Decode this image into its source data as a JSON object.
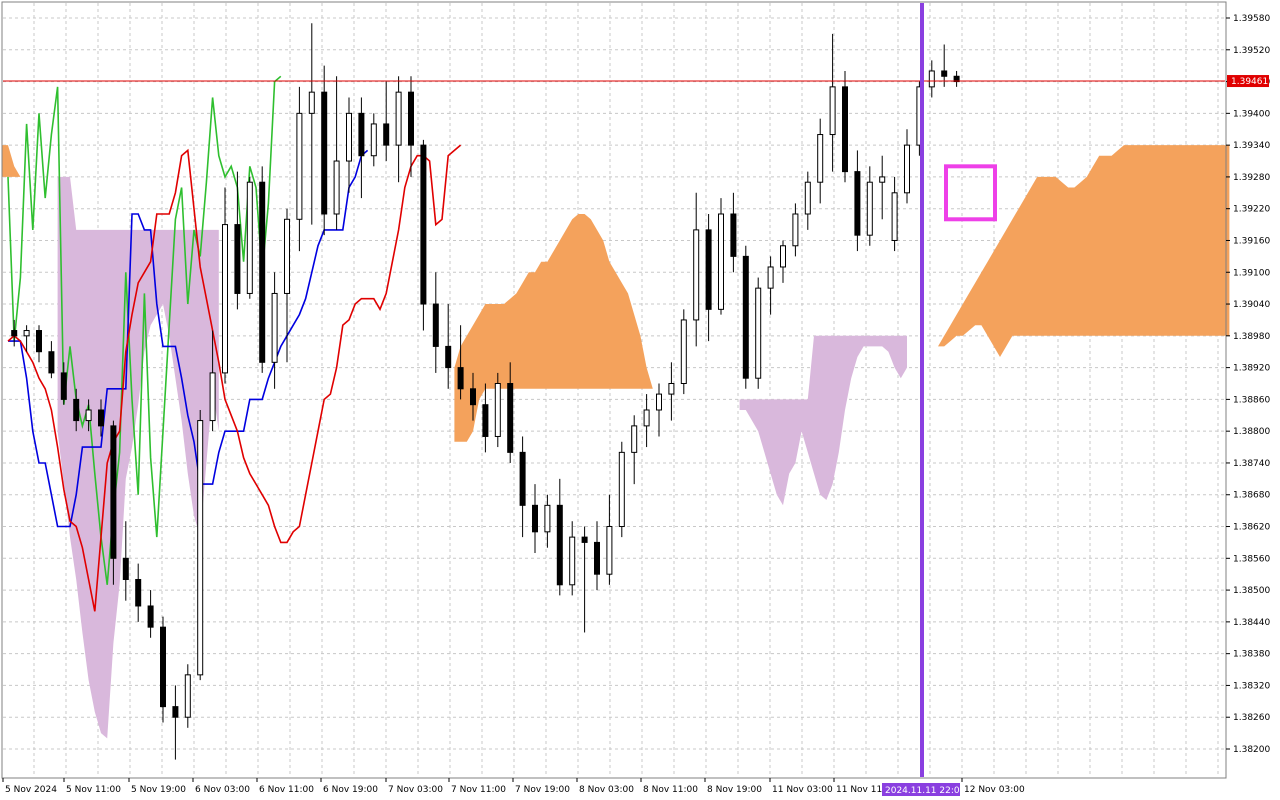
{
  "chart_data": {
    "type": "candlestick",
    "instrument_price_axis": {
      "ylim": [
        1.3817,
        1.3961
      ],
      "ticks": [
        "1.39580",
        "1.39520",
        "1.39460",
        "1.39400",
        "1.39340",
        "1.39280",
        "1.39220",
        "1.39160",
        "1.39100",
        "1.39040",
        "1.38980",
        "1.38920",
        "1.38860",
        "1.38800",
        "1.38740",
        "1.38680",
        "1.38620",
        "1.38560",
        "1.38500",
        "1.38440",
        "1.38380",
        "1.38320",
        "1.38260",
        "1.38200"
      ]
    },
    "time_axis": {
      "ticks": [
        "5 Nov 2024",
        "5 Nov 11:00",
        "5 Nov 19:00",
        "6 Nov 03:00",
        "6 Nov 11:00",
        "6 Nov 19:00",
        "7 Nov 03:00",
        "7 Nov 11:00",
        "7 Nov 19:00",
        "8 Nov 03:00",
        "8 Nov 11:00",
        "8 Nov 19:00",
        "11 Nov 03:00",
        "11 Nov 11:00",
        "12 Nov 03:00"
      ]
    },
    "current_price": {
      "label": "1.39461",
      "value": 1.39461,
      "color": "#e00000"
    },
    "vertical_marker": {
      "label": "2024.11.11 22:00",
      "color": "#8a3fe0"
    },
    "highlight_box": {
      "color": "#ee40e8",
      "price_range": [
        1.392,
        1.393
      ]
    },
    "colors": {
      "grid": "#c8c8c8",
      "tenkan": "#e00000",
      "kijun": "#0000e0",
      "chikou": "#2fbf2f",
      "kumo_bull": "#f4a25c",
      "kumo_bear": "#d9b8dc",
      "candle_bull": "#ffffff",
      "candle_bear": "#000000"
    },
    "tenkan": [
      1.3897,
      1.3898,
      1.3897,
      1.3895,
      1.3893,
      1.389,
      1.3888,
      1.3884,
      1.3877,
      1.3869,
      1.3863,
      1.3862,
      1.3858,
      1.3852,
      1.3846,
      1.386,
      1.3874,
      1.3878,
      1.388,
      1.3895,
      1.3902,
      1.3908,
      1.391,
      1.3912,
      1.3921,
      1.3921,
      1.3921,
      1.3925,
      1.3932,
      1.3933,
      1.3922,
      1.3911,
      1.3905,
      1.3899,
      1.3893,
      1.3886,
      1.3883,
      1.388,
      1.3875,
      1.3872,
      1.387,
      1.3868,
      1.3866,
      1.3862,
      1.3859,
      1.3859,
      1.3861,
      1.3862,
      1.3868,
      1.3874,
      1.388,
      1.3886,
      1.3887,
      1.3892,
      1.39,
      1.3901,
      1.3904,
      1.3905,
      1.3905,
      1.3905,
      1.3903,
      1.3906,
      1.3912,
      1.3918,
      1.3926,
      1.393,
      1.3932,
      1.3932,
      1.3931,
      1.3919,
      1.392,
      1.3932,
      1.3933,
      1.3934
    ],
    "kijun": [
      1.3897,
      1.3897,
      1.3897,
      1.389,
      1.388,
      1.3874,
      1.3874,
      1.3868,
      1.3862,
      1.3862,
      1.3862,
      1.3868,
      1.3877,
      1.3877,
      1.3877,
      1.3877,
      1.3888,
      1.3888,
      1.3888,
      1.3888,
      1.3921,
      1.3921,
      1.3918,
      1.3918,
      1.3904,
      1.3896,
      1.3896,
      1.3896,
      1.389,
      1.3883,
      1.3878,
      1.387,
      1.387,
      1.387,
      1.3876,
      1.388,
      1.388,
      1.388,
      1.388,
      1.3886,
      1.3886,
      1.3886,
      1.389,
      1.3893,
      1.3896,
      1.3898,
      1.39,
      1.3902,
      1.3905,
      1.391,
      1.3915,
      1.3918,
      1.3918,
      1.3918,
      1.3918,
      1.3926,
      1.3928,
      1.3932,
      1.3933
    ],
    "chikou": [
      1.3928,
      1.3897,
      1.3909,
      1.3938,
      1.3918,
      1.394,
      1.3924,
      1.3936,
      1.3945,
      1.3885,
      1.3896,
      1.3886,
      1.3881,
      1.3885,
      1.3872,
      1.386,
      1.3851,
      1.3865,
      1.3876,
      1.391,
      1.3886,
      1.3868,
      1.3906,
      1.3875,
      1.386,
      1.388,
      1.39,
      1.392,
      1.3926,
      1.3904,
      1.3918,
      1.3913,
      1.3927,
      1.3943,
      1.3932,
      1.3928,
      1.393,
      1.3926,
      1.3912,
      1.393,
      1.3926,
      1.391,
      1.3923,
      1.3946,
      1.3947
    ],
    "candles": [
      {
        "o": 1.3899,
        "h": 1.3901,
        "l": 1.3896,
        "c": 1.3898
      },
      {
        "o": 1.3898,
        "h": 1.39,
        "l": 1.3895,
        "c": 1.3899
      },
      {
        "o": 1.3899,
        "h": 1.39,
        "l": 1.3893,
        "c": 1.3895
      },
      {
        "o": 1.3895,
        "h": 1.3897,
        "l": 1.389,
        "c": 1.3891
      },
      {
        "o": 1.3891,
        "h": 1.3893,
        "l": 1.3885,
        "c": 1.3886
      },
      {
        "o": 1.3886,
        "h": 1.3888,
        "l": 1.388,
        "c": 1.3882
      },
      {
        "o": 1.3882,
        "h": 1.3886,
        "l": 1.388,
        "c": 1.3884
      },
      {
        "o": 1.3884,
        "h": 1.3886,
        "l": 1.3879,
        "c": 1.3881
      },
      {
        "o": 1.3881,
        "h": 1.3882,
        "l": 1.3851,
        "c": 1.3856
      },
      {
        "o": 1.3856,
        "h": 1.3863,
        "l": 1.3848,
        "c": 1.3852
      },
      {
        "o": 1.3852,
        "h": 1.3855,
        "l": 1.3844,
        "c": 1.3847
      },
      {
        "o": 1.3847,
        "h": 1.385,
        "l": 1.3841,
        "c": 1.3843
      },
      {
        "o": 1.3843,
        "h": 1.3845,
        "l": 1.3825,
        "c": 1.3828
      },
      {
        "o": 1.3828,
        "h": 1.3832,
        "l": 1.3818,
        "c": 1.3826
      },
      {
        "o": 1.3826,
        "h": 1.3836,
        "l": 1.3824,
        "c": 1.3834
      },
      {
        "o": 1.3834,
        "h": 1.3884,
        "l": 1.3833,
        "c": 1.3882
      },
      {
        "o": 1.3882,
        "h": 1.3899,
        "l": 1.388,
        "c": 1.3891
      },
      {
        "o": 1.3891,
        "h": 1.3926,
        "l": 1.3889,
        "c": 1.3919
      },
      {
        "o": 1.3919,
        "h": 1.3929,
        "l": 1.3903,
        "c": 1.3906
      },
      {
        "o": 1.3906,
        "h": 1.3928,
        "l": 1.3905,
        "c": 1.3927
      },
      {
        "o": 1.3927,
        "h": 1.393,
        "l": 1.3891,
        "c": 1.3893
      },
      {
        "o": 1.3893,
        "h": 1.391,
        "l": 1.3888,
        "c": 1.3906
      },
      {
        "o": 1.3906,
        "h": 1.3922,
        "l": 1.3893,
        "c": 1.392
      },
      {
        "o": 1.392,
        "h": 1.3945,
        "l": 1.3914,
        "c": 1.394
      },
      {
        "o": 1.394,
        "h": 1.3957,
        "l": 1.3919,
        "c": 1.3944
      },
      {
        "o": 1.3944,
        "h": 1.3949,
        "l": 1.3917,
        "c": 1.3921
      },
      {
        "o": 1.3921,
        "h": 1.3947,
        "l": 1.3918,
        "c": 1.3931
      },
      {
        "o": 1.3931,
        "h": 1.3943,
        "l": 1.3925,
        "c": 1.394
      },
      {
        "o": 1.394,
        "h": 1.3943,
        "l": 1.3924,
        "c": 1.3932
      },
      {
        "o": 1.3932,
        "h": 1.394,
        "l": 1.393,
        "c": 1.3938
      },
      {
        "o": 1.3938,
        "h": 1.3946,
        "l": 1.3931,
        "c": 1.3934
      },
      {
        "o": 1.3934,
        "h": 1.3947,
        "l": 1.3927,
        "c": 1.3944
      },
      {
        "o": 1.3944,
        "h": 1.3947,
        "l": 1.3928,
        "c": 1.3934
      },
      {
        "o": 1.3934,
        "h": 1.3935,
        "l": 1.3899,
        "c": 1.3904
      },
      {
        "o": 1.3904,
        "h": 1.391,
        "l": 1.3891,
        "c": 1.3896
      },
      {
        "o": 1.3896,
        "h": 1.3904,
        "l": 1.3888,
        "c": 1.3892
      },
      {
        "o": 1.3892,
        "h": 1.39,
        "l": 1.3886,
        "c": 1.3888
      },
      {
        "o": 1.3888,
        "h": 1.3891,
        "l": 1.3882,
        "c": 1.3885
      },
      {
        "o": 1.3885,
        "h": 1.3889,
        "l": 1.3876,
        "c": 1.3879
      },
      {
        "o": 1.3879,
        "h": 1.3891,
        "l": 1.3877,
        "c": 1.3889
      },
      {
        "o": 1.3889,
        "h": 1.3893,
        "l": 1.3874,
        "c": 1.3876
      },
      {
        "o": 1.3876,
        "h": 1.3879,
        "l": 1.386,
        "c": 1.3866
      },
      {
        "o": 1.3866,
        "h": 1.387,
        "l": 1.3857,
        "c": 1.3861
      },
      {
        "o": 1.3861,
        "h": 1.3868,
        "l": 1.3858,
        "c": 1.3866
      },
      {
        "o": 1.3866,
        "h": 1.3871,
        "l": 1.3849,
        "c": 1.3851
      },
      {
        "o": 1.3851,
        "h": 1.3863,
        "l": 1.3849,
        "c": 1.386
      },
      {
        "o": 1.386,
        "h": 1.3862,
        "l": 1.3842,
        "c": 1.3859
      },
      {
        "o": 1.3859,
        "h": 1.3863,
        "l": 1.385,
        "c": 1.3853
      },
      {
        "o": 1.3853,
        "h": 1.3868,
        "l": 1.3851,
        "c": 1.3862
      },
      {
        "o": 1.3862,
        "h": 1.3878,
        "l": 1.386,
        "c": 1.3876
      },
      {
        "o": 1.3876,
        "h": 1.3883,
        "l": 1.387,
        "c": 1.3881
      },
      {
        "o": 1.3881,
        "h": 1.3887,
        "l": 1.3877,
        "c": 1.3884
      },
      {
        "o": 1.3884,
        "h": 1.3889,
        "l": 1.3879,
        "c": 1.3887
      },
      {
        "o": 1.3887,
        "h": 1.3893,
        "l": 1.3882,
        "c": 1.3889
      },
      {
        "o": 1.3889,
        "h": 1.3903,
        "l": 1.3887,
        "c": 1.3901
      },
      {
        "o": 1.3901,
        "h": 1.3925,
        "l": 1.3896,
        "c": 1.3918
      },
      {
        "o": 1.3918,
        "h": 1.3921,
        "l": 1.3897,
        "c": 1.3903
      },
      {
        "o": 1.3903,
        "h": 1.3924,
        "l": 1.3902,
        "c": 1.3921
      },
      {
        "o": 1.3921,
        "h": 1.3925,
        "l": 1.391,
        "c": 1.3913
      },
      {
        "o": 1.3913,
        "h": 1.3915,
        "l": 1.3888,
        "c": 1.389
      },
      {
        "o": 1.389,
        "h": 1.3909,
        "l": 1.3888,
        "c": 1.3907
      },
      {
        "o": 1.3907,
        "h": 1.3913,
        "l": 1.3902,
        "c": 1.3911
      },
      {
        "o": 1.3911,
        "h": 1.3916,
        "l": 1.3908,
        "c": 1.3915
      },
      {
        "o": 1.3915,
        "h": 1.3923,
        "l": 1.3913,
        "c": 1.3921
      },
      {
        "o": 1.3921,
        "h": 1.3929,
        "l": 1.3918,
        "c": 1.3927
      },
      {
        "o": 1.3927,
        "h": 1.3939,
        "l": 1.3923,
        "c": 1.3936
      },
      {
        "o": 1.3936,
        "h": 1.3955,
        "l": 1.3929,
        "c": 1.3945
      },
      {
        "o": 1.3945,
        "h": 1.3948,
        "l": 1.3927,
        "c": 1.3929
      },
      {
        "o": 1.3929,
        "h": 1.3933,
        "l": 1.3914,
        "c": 1.3917
      },
      {
        "o": 1.3917,
        "h": 1.393,
        "l": 1.3915,
        "c": 1.3927
      },
      {
        "o": 1.3927,
        "h": 1.3932,
        "l": 1.392,
        "c": 1.3928
      },
      {
        "o": 1.3916,
        "h": 1.3928,
        "l": 1.3914,
        "c": 1.3925
      },
      {
        "o": 1.3925,
        "h": 1.3937,
        "l": 1.3923,
        "c": 1.3934
      },
      {
        "o": 1.3934,
        "h": 1.3946,
        "l": 1.3932,
        "c": 1.3945
      },
      {
        "o": 1.3945,
        "h": 1.395,
        "l": 1.3943,
        "c": 1.3948
      },
      {
        "o": 1.3948,
        "h": 1.3953,
        "l": 1.3945,
        "c": 1.3947
      },
      {
        "o": 1.3947,
        "h": 1.3948,
        "l": 1.3945,
        "c": 1.3946
      }
    ],
    "kumo_orange_top": [
      1.3936,
      1.3925,
      1.3925,
      1.3922,
      1.392,
      1.3918,
      1.3914,
      1.3908,
      1.3905,
      1.39,
      1.3897,
      1.3896,
      1.3896,
      1.3893,
      1.3889,
      1.3888,
      1.3886,
      1.3885,
      1.3883,
      1.3881,
      1.3879,
      1.388,
      1.3881,
      1.3885,
      1.3886,
      1.389,
      1.3895,
      1.3903,
      1.3911,
      1.3917,
      1.3927,
      1.3931,
      1.3931,
      1.3929,
      1.393,
      1.3932,
      1.3936,
      1.3934
    ],
    "kumo_purple_bottom": [
      1.388,
      1.387,
      1.386,
      1.3852,
      1.3842,
      1.3833,
      1.3827,
      1.3823,
      1.3822,
      1.384,
      1.3851,
      1.3871,
      1.3877,
      1.3885,
      1.3895,
      1.39,
      1.3902,
      1.3904,
      1.3898,
      1.389,
      1.3882,
      1.3872,
      1.3864,
      1.386,
      1.3874,
      1.3888,
      1.388
    ]
  }
}
